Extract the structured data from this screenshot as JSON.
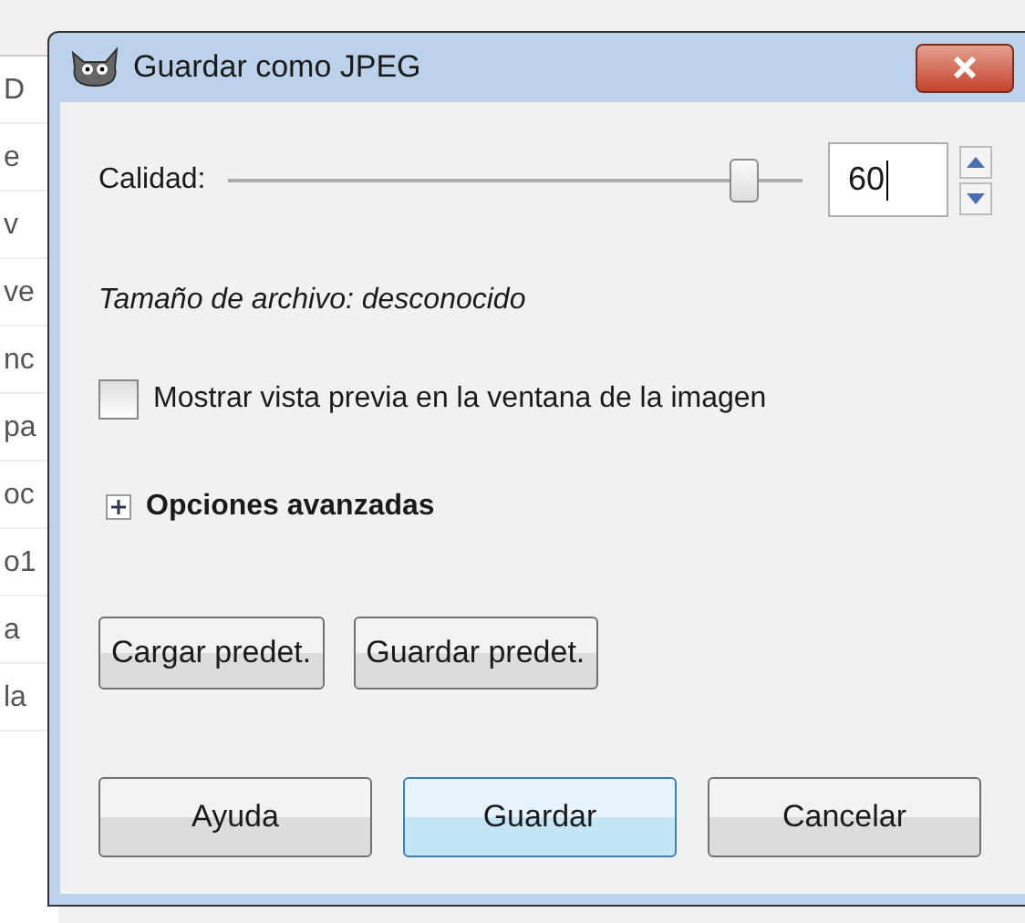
{
  "background_window": {
    "row_fragments": [
      "D",
      "e",
      "v",
      "ve",
      "nc",
      "pa",
      "oc",
      "o1",
      "a",
      "la"
    ]
  },
  "dialog": {
    "title": "Guardar como JPEG",
    "quality": {
      "label": "Calidad:",
      "level": 0.9,
      "value": "60"
    },
    "file_size": "Tamaño de archivo: desconocido",
    "preview": {
      "label": "Mostrar vista previa en la ventana de la imagen",
      "checked": false
    },
    "advanced": {
      "label": "Opciones avanzadas",
      "expanded": false
    },
    "default_buttons": [
      {
        "label": "Cargar predet."
      },
      {
        "label": "Guardar predet."
      }
    ],
    "buttons": [
      {
        "label": "Ayuda",
        "selected": false
      },
      {
        "label": "Guardar",
        "selected": true
      },
      {
        "label": "Cancelar",
        "selected": false
      }
    ]
  }
}
